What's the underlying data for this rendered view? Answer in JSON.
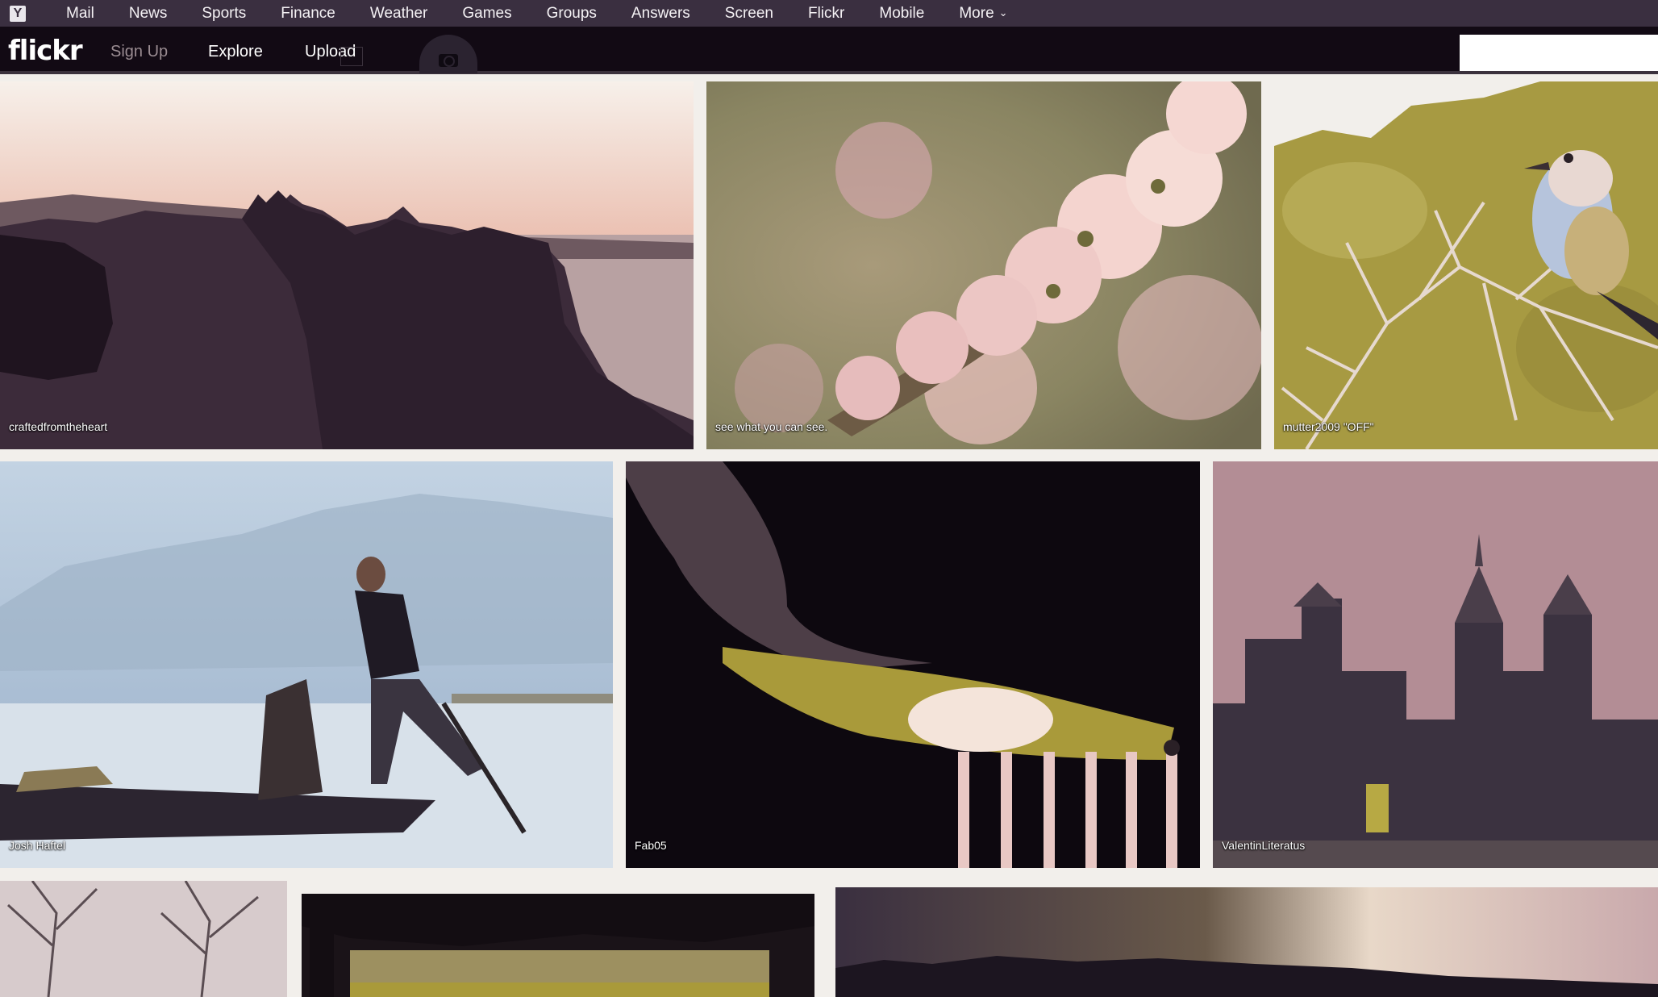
{
  "yahoo_bar": {
    "logo": "Y",
    "nav": [
      "Mail",
      "News",
      "Sports",
      "Finance",
      "Weather",
      "Games",
      "Groups",
      "Answers",
      "Screen",
      "Flickr",
      "Mobile",
      "More"
    ]
  },
  "flickr_bar": {
    "logo": "flickr",
    "signup": "Sign Up",
    "explore": "Explore",
    "upload": "Upload",
    "search_value": ""
  },
  "photos": [
    {
      "caption": "craftedfromtheheart",
      "subject": "castle ruins silhouette at sunset"
    },
    {
      "caption": "see what you can see.",
      "subject": "cherry blossoms"
    },
    {
      "caption": "mutter2009 \"OFF\"",
      "subject": "bird on thorny branch"
    },
    {
      "caption": "Josh Haftel",
      "subject": "fisherman on boat"
    },
    {
      "caption": "Fab05",
      "subject": "burning matches"
    },
    {
      "caption": "ValentinLiteratus",
      "subject": "city skyline"
    },
    {
      "caption": "",
      "subject": "bare trees"
    },
    {
      "caption": "",
      "subject": "tree silhouette over field"
    },
    {
      "caption": "",
      "subject": "sunset sky over treeline"
    }
  ]
}
